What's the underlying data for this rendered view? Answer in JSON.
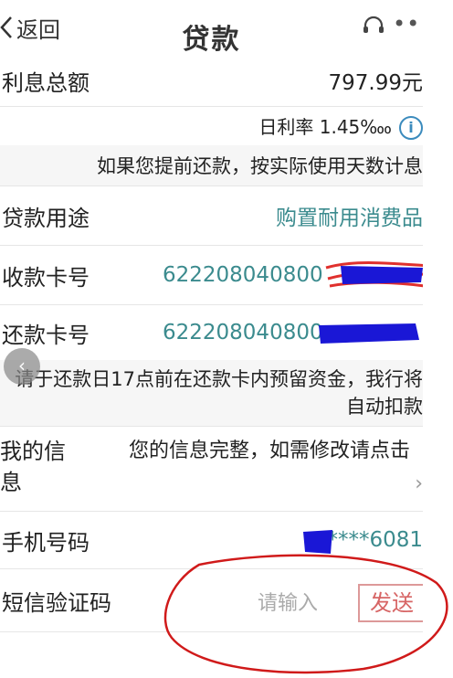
{
  "header": {
    "back_label": "返回",
    "title": "贷款",
    "support_icon": "headset-icon",
    "more_icon": "more-icon"
  },
  "rows": {
    "interest_total": {
      "label": "利息总额",
      "value": "797.99元"
    },
    "daily_rate": {
      "value": "日利率 1.45‱"
    },
    "early_repay_note": "如果您提前还款，按实际使用天数计息",
    "loan_purpose": {
      "label": "贷款用途",
      "value": "购置耐用消费品"
    },
    "receive_card": {
      "label": "收款卡号",
      "value": "622208040800"
    },
    "repay_card": {
      "label": "还款卡号",
      "value": "622208040800"
    },
    "repay_note": "请于还款日17点前在还款卡内预留资金，我行将自动扣款",
    "my_info": {
      "label": "我的信息",
      "value": "您的信息完整，如需修改请点击"
    },
    "phone": {
      "label": "手机号码",
      "value": "****6081"
    },
    "sms_code": {
      "label": "短信验证码",
      "placeholder": "请输入",
      "send_label": "发送"
    }
  },
  "colors": {
    "accent": "#3b8b8e",
    "send": "#d76565",
    "redact_blue": "#1a17d6",
    "redact_red": "#e0302d",
    "annotation_red": "#d01a1a"
  }
}
